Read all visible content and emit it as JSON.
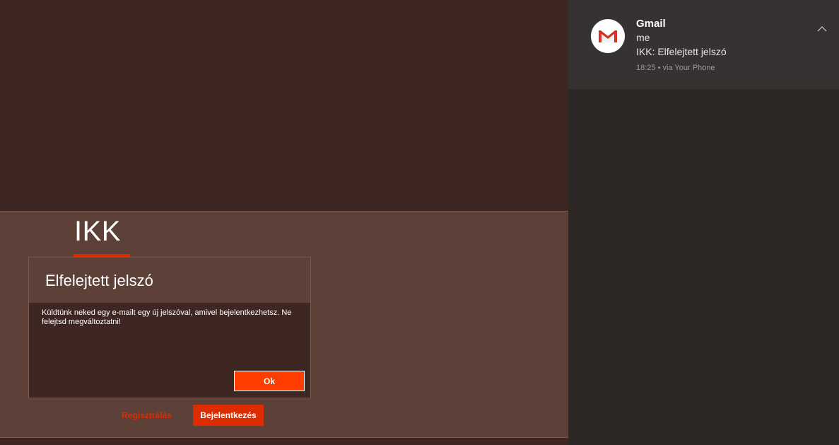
{
  "app": {
    "brand": "IKK",
    "dialog": {
      "title": "Elfelejtett jelszó",
      "message": "Küldtünk neked egy e-mailt egy új jelszóval, amivel bejelentkezhetsz. Ne felejtsd megváltoztatni!",
      "ok_label": "Ok"
    },
    "register_label": "Regisztrálás",
    "login_label": "Bejelentkezés"
  },
  "notification": {
    "app_name": "Gmail",
    "sender": "me",
    "subject": "IKK: Elfelejtett jelszó",
    "meta": "18:25 • via Your Phone",
    "icon": "gmail-icon"
  },
  "colors": {
    "background": "#3e2723",
    "band": "#5d4037",
    "accent": "#dd2c00",
    "ok_button": "#ff3d00",
    "action_center": "#2d2826"
  }
}
